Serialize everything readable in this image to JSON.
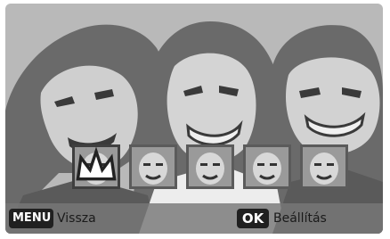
{
  "scene": {
    "description_icon": "three-people-faces-photo"
  },
  "face_thumbnails": {
    "count": 5,
    "selected_index": 0,
    "selected_marker_icon": "crown-icon"
  },
  "bottom_bar": {
    "menu_key": "MENU",
    "menu_action": "Vissza",
    "ok_key": "OK",
    "ok_action": "Beállítás"
  },
  "colors": {
    "background": "#b9b9b9",
    "bar": "#787878",
    "key": "#202020",
    "thumb_border": "#5b5b5b"
  }
}
